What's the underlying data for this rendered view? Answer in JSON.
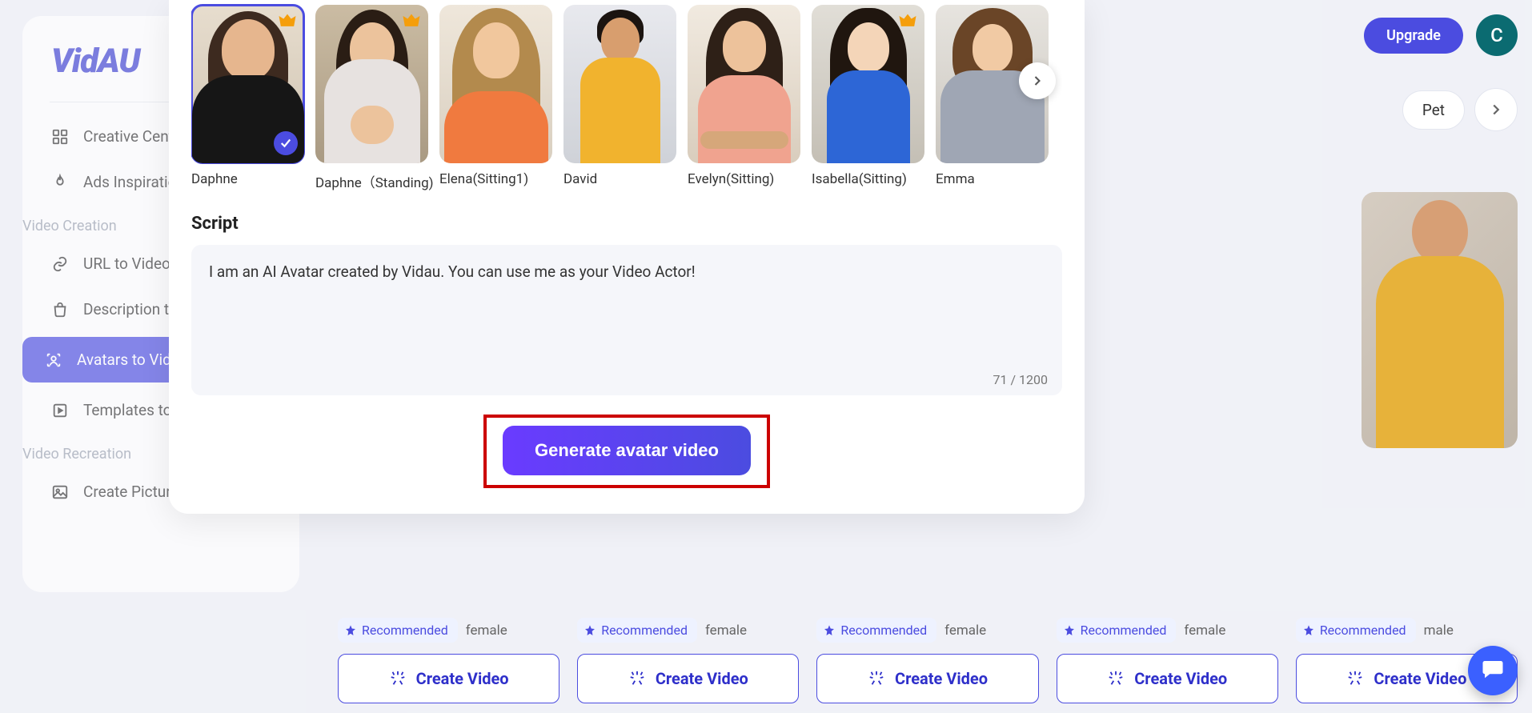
{
  "brand": {
    "name": "VidAU"
  },
  "topbar": {
    "upgrade_label": "Upgrade",
    "avatar_initial": "C"
  },
  "sidebar": {
    "items": [
      {
        "label": "Creative Center",
        "icon": "grid"
      },
      {
        "label": "Ads Inspiration",
        "icon": "flame"
      }
    ],
    "section_creation_title": "Video Creation",
    "creation": [
      {
        "label": "URL to Video",
        "icon": "link"
      },
      {
        "label": "Description to Video",
        "icon": "bag"
      },
      {
        "label": "Avatars to Video",
        "icon": "avatar-scan",
        "active": true
      },
      {
        "label": "Templates to Video",
        "icon": "play"
      }
    ],
    "section_recreation_title": "Video Recreation",
    "recreation": [
      {
        "label": "Create Picture Avatar",
        "icon": "image"
      }
    ]
  },
  "chips": [
    "Pet"
  ],
  "bg_cards": [
    {
      "recommended": true,
      "gender": "female",
      "cta": "Create Video"
    },
    {
      "recommended": true,
      "gender": "female",
      "cta": "Create Video"
    },
    {
      "recommended": true,
      "gender": "female",
      "cta": "Create Video"
    },
    {
      "recommended": true,
      "gender": "female",
      "cta": "Create Video"
    },
    {
      "recommended": true,
      "gender": "male",
      "cta": "Create Video"
    }
  ],
  "recommended_label": "Recommended",
  "modal": {
    "avatars": [
      {
        "name": "Daphne",
        "premium": true,
        "selected": true
      },
      {
        "name": "Daphne（Standing)",
        "premium": true
      },
      {
        "name": "Elena(Sitting1)"
      },
      {
        "name": "David"
      },
      {
        "name": "Evelyn(Sitting)"
      },
      {
        "name": "Isabella(Sitting)",
        "premium": true
      },
      {
        "name": "Emma"
      }
    ],
    "script_heading": "Script",
    "script_value": "I am an AI Avatar created by Vidau. You can use me as your Video Actor!",
    "char_count": "71 / 1200",
    "generate_label": "Generate avatar video"
  }
}
